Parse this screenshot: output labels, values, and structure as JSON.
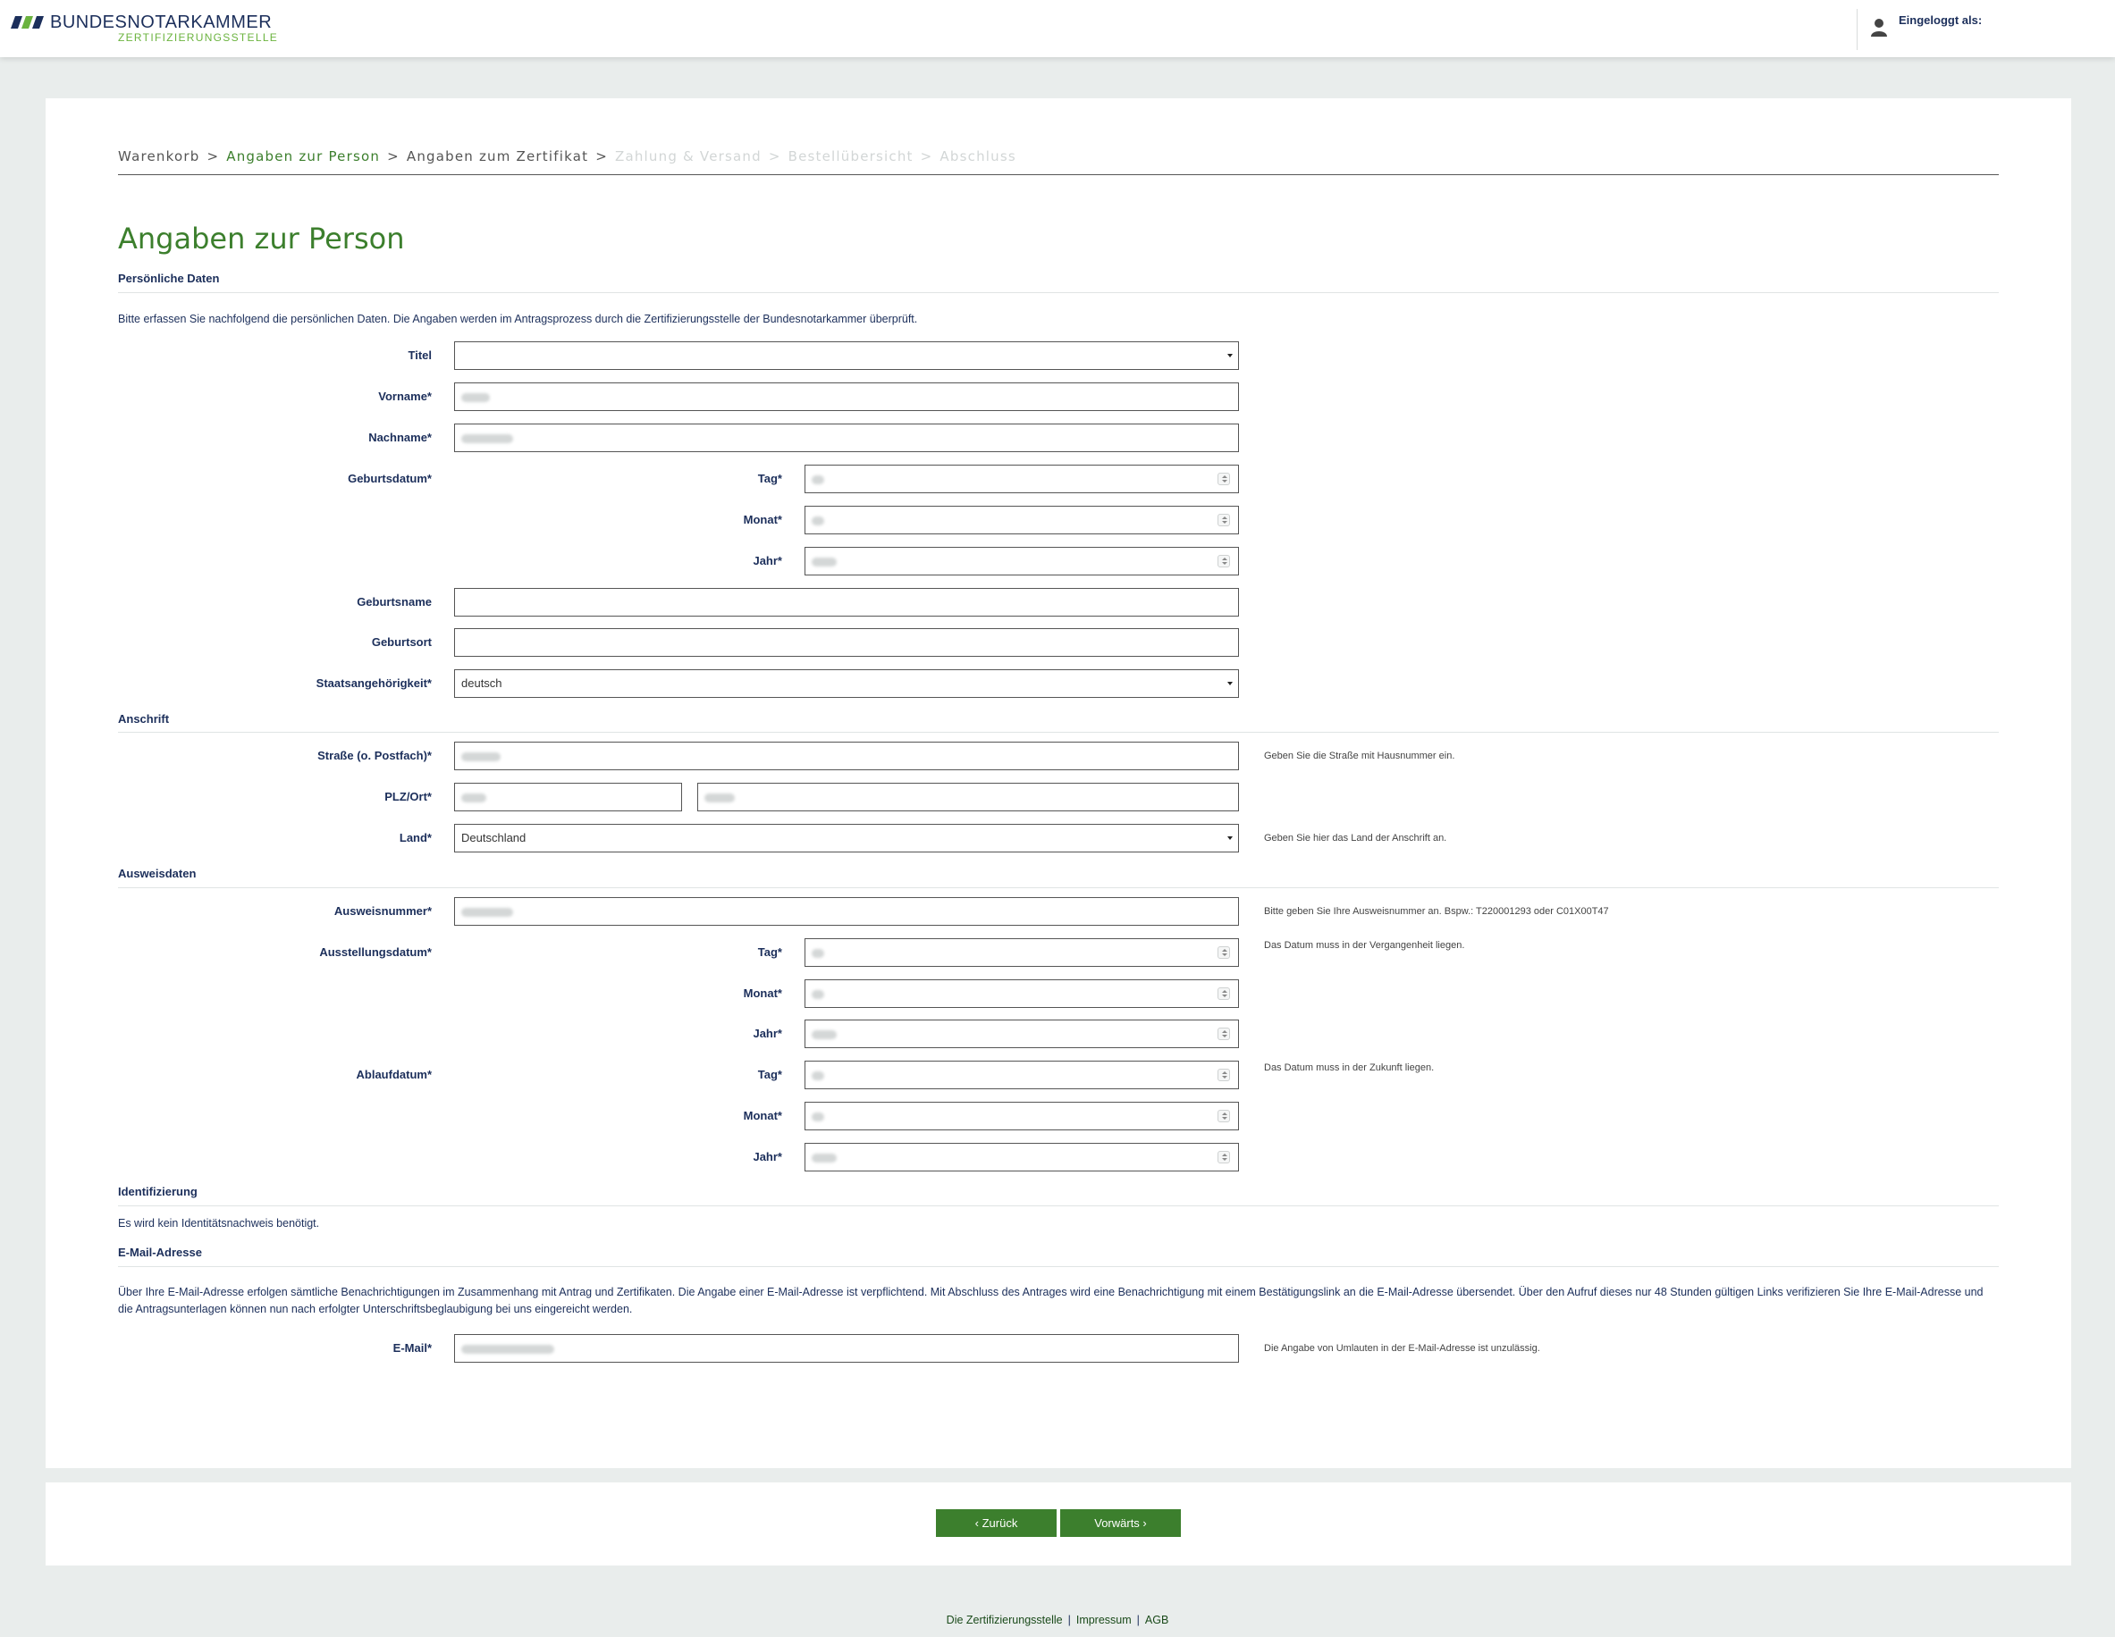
{
  "header": {
    "brand_title": "BUNDESNOTARKAMMER",
    "brand_subtitle": "ZERTIFIZIERUNGSSTELLE",
    "logged_in_label": "Eingeloggt als:",
    "brand_colors": {
      "navy": "#1c2f5b",
      "green": "#6bb33f",
      "dark_green": "#3c7f2d"
    }
  },
  "breadcrumb": {
    "items": [
      {
        "label": "Warenkorb",
        "state": "done"
      },
      {
        "label": "Angaben zur Person",
        "state": "active"
      },
      {
        "label": "Angaben zum Zertifikat",
        "state": "done"
      },
      {
        "label": "Zahlung & Versand",
        "state": "disabled"
      },
      {
        "label": "Bestellübersicht",
        "state": "disabled"
      },
      {
        "label": "Abschluss",
        "state": "disabled"
      }
    ],
    "separator": ">"
  },
  "page_title": "Angaben zur Person",
  "personal": {
    "heading": "Persönliche Daten",
    "intro": "Bitte erfassen Sie nachfolgend die persönlichen Daten. Die Angaben werden im Antragsprozess durch die Zertifizierungsstelle der Bundesnotarkammer überprüft.",
    "titel_label": "Titel",
    "titel_value": "",
    "vorname_label": "Vorname*",
    "nachname_label": "Nachname*",
    "geburtsdatum_label": "Geburtsdatum*",
    "tag_label": "Tag*",
    "monat_label": "Monat*",
    "jahr_label": "Jahr*",
    "geburtsname_label": "Geburtsname",
    "geburtsname_value": "",
    "geburtsort_label": "Geburtsort",
    "geburtsort_value": "",
    "staatsangehoerigkeit_label": "Staatsangehörigkeit*",
    "staatsangehoerigkeit_value": "deutsch"
  },
  "address": {
    "heading": "Anschrift",
    "strasse_label": "Straße (o. Postfach)*",
    "strasse_hint": "Geben Sie die Straße mit Hausnummer ein.",
    "plz_ort_label": "PLZ/Ort*",
    "land_label": "Land*",
    "land_value": "Deutschland",
    "land_hint": "Geben Sie hier das Land der Anschrift an."
  },
  "id_data": {
    "heading": "Ausweisdaten",
    "ausweisnummer_label": "Ausweisnummer*",
    "ausweisnummer_hint": "Bitte geben Sie Ihre Ausweisnummer an. Bspw.: T220001293 oder C01X00T47",
    "ausstellungsdatum_label": "Ausstellungsdatum*",
    "ausstellungsdatum_hint": "Das Datum muss in der Vergangenheit liegen.",
    "ablaufdatum_label": "Ablaufdatum*",
    "ablaufdatum_hint": "Das Datum muss in der Zukunft liegen.",
    "tag_label": "Tag*",
    "monat_label": "Monat*",
    "jahr_label": "Jahr*"
  },
  "identification": {
    "heading": "Identifizierung",
    "text": "Es wird kein Identitätsnachweis benötigt."
  },
  "email": {
    "heading": "E-Mail-Adresse",
    "text": "Über Ihre E-Mail-Adresse erfolgen sämtliche Benachrichtigungen im Zusammenhang mit Antrag und Zertifikaten. Die Angabe einer E-Mail-Adresse ist verpflichtend. Mit Abschluss des Antrages wird eine Benachrichtigung mit einem Bestätigungslink an die E-Mail-Adresse übersendet. Über den Aufruf dieses nur 48 Stunden gültigen Links verifizieren Sie Ihre E-Mail-Adresse und die Antragsunterlagen können nun nach erfolgter Unterschriftsbeglaubigung bei uns eingereicht werden.",
    "label": "E-Mail*",
    "hint": "Die Angabe von Umlauten in der E-Mail-Adresse ist unzulässig."
  },
  "actions": {
    "back_label": "‹ Zurück",
    "next_label": "Vorwärts ›"
  },
  "footer": {
    "links": [
      "Die Zertifizierungsstelle",
      "Impressum",
      "AGB"
    ],
    "separator": "|"
  }
}
